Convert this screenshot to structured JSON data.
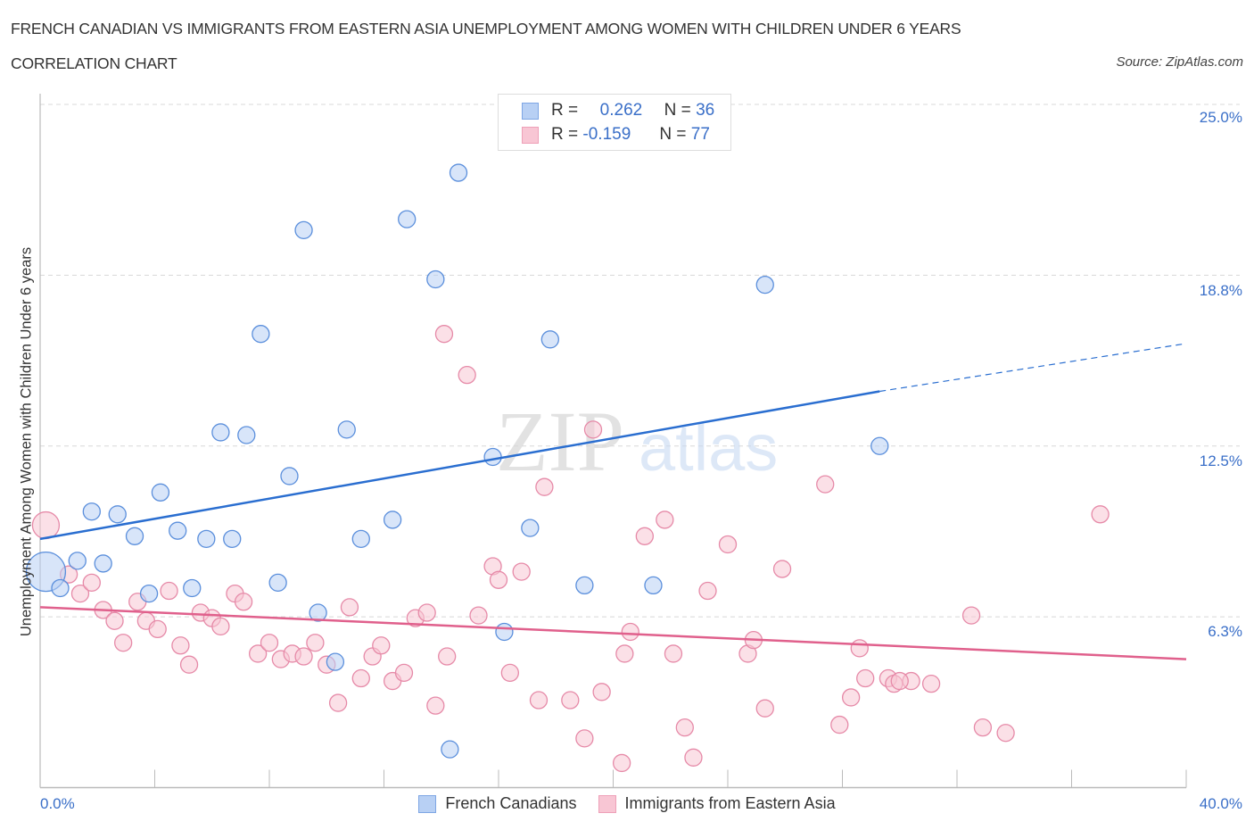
{
  "header": {
    "title": "FRENCH CANADIAN VS IMMIGRANTS FROM EASTERN ASIA UNEMPLOYMENT AMONG WOMEN WITH CHILDREN UNDER 6 YEARS",
    "subtitle": "CORRELATION CHART",
    "source": "Source: ZipAtlas.com"
  },
  "watermark": {
    "zip": "ZIP",
    "atlas": "atlas"
  },
  "legend_stats": [
    {
      "series": "French Canadians",
      "r_label": "R =",
      "r_value": "0.262",
      "n_label": "N =",
      "n_value": "36"
    },
    {
      "series": "Immigrants from Eastern Asia",
      "r_label": "R =",
      "r_value": "-0.159",
      "n_label": "N =",
      "n_value": "77"
    }
  ],
  "colors": {
    "blue_fill": "#b8d0f4",
    "blue_stroke": "#5b8fdc",
    "blue_line": "#2a6ed0",
    "pink_fill": "#f8c6d4",
    "pink_stroke": "#e68aa8",
    "pink_line": "#e0608c",
    "tick_text": "#3a6fc8"
  },
  "chart_data": {
    "type": "scatter",
    "title": "FRENCH CANADIAN VS IMMIGRANTS FROM EASTERN ASIA UNEMPLOYMENT AMONG WOMEN WITH CHILDREN UNDER 6 YEARS",
    "subtitle": "CORRELATION CHART",
    "xlabel": "",
    "ylabel": "Unemployment Among Women with Children Under 6 years",
    "xlim": [
      0,
      40
    ],
    "ylim": [
      0,
      25
    ],
    "x_tick_labels": [
      "0.0%",
      "40.0%"
    ],
    "y_ticks": [
      6.25,
      12.5,
      18.75,
      25
    ],
    "y_tick_labels": [
      "6.3%",
      "12.5%",
      "18.8%",
      "25.0%"
    ],
    "grid": true,
    "legend_position": "bottom",
    "series": [
      {
        "name": "French Canadians",
        "color": "#5b8fdc",
        "r": 0.262,
        "n": 36,
        "trend": {
          "x": [
            0,
            29.3
          ],
          "y": [
            9.1,
            14.5
          ],
          "extend_dashed_to_x": 40,
          "extend_dashed_y": 16.25
        },
        "points": [
          [
            0.2,
            7.9,
            3
          ],
          [
            0.7,
            7.3,
            1
          ],
          [
            1.3,
            8.3,
            1
          ],
          [
            1.8,
            10.1,
            1
          ],
          [
            2.7,
            10.0,
            1
          ],
          [
            2.2,
            8.2,
            1
          ],
          [
            3.3,
            9.2,
            1
          ],
          [
            4.2,
            10.8,
            1
          ],
          [
            3.8,
            7.1,
            1
          ],
          [
            4.8,
            9.4,
            1
          ],
          [
            5.3,
            7.3,
            1
          ],
          [
            5.8,
            9.1,
            1
          ],
          [
            6.3,
            13.0,
            1
          ],
          [
            6.7,
            9.1,
            1
          ],
          [
            7.2,
            12.9,
            1
          ],
          [
            7.7,
            16.6,
            1
          ],
          [
            8.3,
            7.5,
            1
          ],
          [
            8.7,
            11.4,
            1
          ],
          [
            9.2,
            20.4,
            1
          ],
          [
            9.7,
            6.4,
            1
          ],
          [
            10.3,
            4.6,
            1
          ],
          [
            10.7,
            13.1,
            1
          ],
          [
            11.2,
            9.1,
            1
          ],
          [
            12.3,
            9.8,
            1
          ],
          [
            12.8,
            20.8,
            1
          ],
          [
            13.8,
            18.6,
            1
          ],
          [
            14.3,
            1.4,
            1
          ],
          [
            14.6,
            22.5,
            1
          ],
          [
            15.8,
            12.1,
            1
          ],
          [
            16.2,
            5.7,
            1
          ],
          [
            17.1,
            9.5,
            1
          ],
          [
            17.8,
            16.4,
            1
          ],
          [
            19.0,
            7.4,
            1
          ],
          [
            21.4,
            7.4,
            1
          ],
          [
            25.3,
            18.4,
            1
          ],
          [
            29.3,
            12.5,
            1
          ]
        ]
      },
      {
        "name": "Immigrants from Eastern Asia",
        "color": "#e68aa8",
        "r": -0.159,
        "n": 77,
        "trend": {
          "x": [
            0,
            40
          ],
          "y": [
            6.6,
            4.7
          ]
        },
        "points": [
          [
            0.2,
            9.6,
            2
          ],
          [
            1.0,
            7.8,
            1
          ],
          [
            1.4,
            7.1,
            1
          ],
          [
            1.8,
            7.5,
            1
          ],
          [
            2.2,
            6.5,
            1
          ],
          [
            2.6,
            6.1,
            1
          ],
          [
            2.9,
            5.3,
            1
          ],
          [
            3.4,
            6.8,
            1
          ],
          [
            3.7,
            6.1,
            1
          ],
          [
            4.1,
            5.8,
            1
          ],
          [
            4.5,
            7.2,
            1
          ],
          [
            4.9,
            5.2,
            1
          ],
          [
            5.2,
            4.5,
            1
          ],
          [
            5.6,
            6.4,
            1
          ],
          [
            6.0,
            6.2,
            1
          ],
          [
            6.3,
            5.9,
            1
          ],
          [
            6.8,
            7.1,
            1
          ],
          [
            7.1,
            6.8,
            1
          ],
          [
            7.6,
            4.9,
            1
          ],
          [
            8.0,
            5.3,
            1
          ],
          [
            8.4,
            4.7,
            1
          ],
          [
            8.8,
            4.9,
            1
          ],
          [
            9.2,
            4.8,
            1
          ],
          [
            9.6,
            5.3,
            1
          ],
          [
            10.0,
            4.5,
            1
          ],
          [
            10.4,
            3.1,
            1
          ],
          [
            10.8,
            6.6,
            1
          ],
          [
            11.2,
            4.0,
            1
          ],
          [
            11.6,
            4.8,
            1
          ],
          [
            11.9,
            5.2,
            1
          ],
          [
            12.3,
            3.9,
            1
          ],
          [
            12.7,
            4.2,
            1
          ],
          [
            13.1,
            6.2,
            1
          ],
          [
            13.5,
            6.4,
            1
          ],
          [
            13.8,
            3.0,
            1
          ],
          [
            14.1,
            16.6,
            1
          ],
          [
            14.2,
            4.8,
            1
          ],
          [
            14.9,
            15.1,
            1
          ],
          [
            15.3,
            6.3,
            1
          ],
          [
            15.8,
            8.1,
            1
          ],
          [
            16.0,
            7.6,
            1
          ],
          [
            16.4,
            4.2,
            1
          ],
          [
            16.8,
            7.9,
            1
          ],
          [
            17.4,
            3.2,
            1
          ],
          [
            17.6,
            11.0,
            1
          ],
          [
            18.5,
            3.2,
            1
          ],
          [
            19.0,
            1.8,
            1
          ],
          [
            19.3,
            13.1,
            1
          ],
          [
            19.6,
            3.5,
            1
          ],
          [
            20.3,
            0.9,
            1
          ],
          [
            20.4,
            4.9,
            1
          ],
          [
            20.6,
            5.7,
            1
          ],
          [
            21.1,
            9.2,
            1
          ],
          [
            21.8,
            9.8,
            1
          ],
          [
            22.1,
            4.9,
            1
          ],
          [
            22.5,
            2.2,
            1
          ],
          [
            22.8,
            1.1,
            1
          ],
          [
            23.3,
            7.2,
            1
          ],
          [
            24.0,
            8.9,
            1
          ],
          [
            24.7,
            4.9,
            1
          ],
          [
            24.9,
            5.4,
            1
          ],
          [
            25.3,
            2.9,
            1
          ],
          [
            25.9,
            8.0,
            1
          ],
          [
            27.4,
            11.1,
            1
          ],
          [
            27.9,
            2.3,
            1
          ],
          [
            28.3,
            3.3,
            1
          ],
          [
            28.6,
            5.1,
            1
          ],
          [
            28.8,
            4.0,
            1
          ],
          [
            29.6,
            4.0,
            1
          ],
          [
            29.8,
            3.8,
            1
          ],
          [
            30.4,
            3.9,
            1
          ],
          [
            31.1,
            3.8,
            1
          ],
          [
            32.5,
            6.3,
            1
          ],
          [
            32.9,
            2.2,
            1
          ],
          [
            33.7,
            2.0,
            1
          ],
          [
            37.0,
            10.0,
            1
          ],
          [
            30.0,
            3.9,
            1
          ]
        ]
      }
    ]
  },
  "axis": {
    "x_min_label": "0.0%",
    "x_max_label": "40.0%",
    "y_labels": [
      "25.0%",
      "18.8%",
      "12.5%",
      "6.3%"
    ],
    "y_title": "Unemployment Among Women with Children Under 6 years"
  },
  "bottom_legend": [
    {
      "label": "French Canadians"
    },
    {
      "label": "Immigrants from Eastern Asia"
    }
  ]
}
